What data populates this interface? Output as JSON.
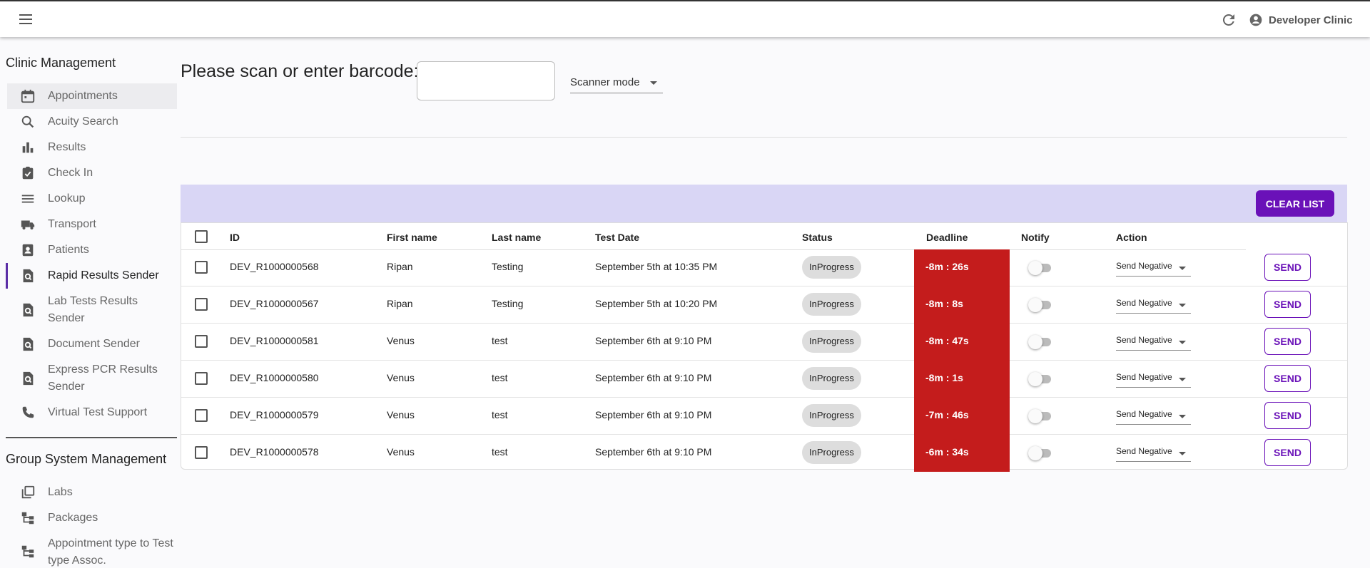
{
  "header": {
    "user_name": "Developer Clinic",
    "menu_icon": "menu-icon",
    "refresh_icon": "refresh-icon",
    "account_icon": "account-circle-icon"
  },
  "sidebar": {
    "clinic_title": "Clinic Management",
    "clinic_items": [
      {
        "label": "Appointments",
        "icon": "calendar-icon"
      },
      {
        "label": "Acuity Search",
        "icon": "search-icon"
      },
      {
        "label": "Results",
        "icon": "bar-chart-icon"
      },
      {
        "label": "Check In",
        "icon": "clipboard-check-icon"
      },
      {
        "label": "Lookup",
        "icon": "list-icon"
      },
      {
        "label": "Transport",
        "icon": "truck-icon"
      },
      {
        "label": "Patients",
        "icon": "contact-icon"
      },
      {
        "label": "Rapid Results Sender",
        "icon": "document-search-icon"
      },
      {
        "label": "Lab Tests Results Sender",
        "icon": "document-search-icon"
      },
      {
        "label": "Document Sender",
        "icon": "document-search-icon"
      },
      {
        "label": "Express PCR Results Sender",
        "icon": "document-search-icon"
      },
      {
        "label": "Virtual Test Support",
        "icon": "phone-icon"
      }
    ],
    "group_title": "Group System Management",
    "group_items": [
      {
        "label": "Labs",
        "icon": "library-icon"
      },
      {
        "label": "Packages",
        "icon": "hierarchy-icon"
      },
      {
        "label": "Appointment type to Test type Assoc.",
        "icon": "hierarchy-icon"
      }
    ]
  },
  "scan": {
    "label": "Please scan or enter barcode:",
    "input_value": "",
    "mode_label": "Scanner mode"
  },
  "clear_button": "CLEAR LIST",
  "table": {
    "headers": {
      "id": "ID",
      "first": "First name",
      "last": "Last name",
      "date": "Test Date",
      "status": "Status",
      "deadline": "Deadline",
      "notify": "Notify",
      "action": "Action"
    },
    "rows": [
      {
        "id": "DEV_R1000000568",
        "first": "Ripan",
        "last": "Testing",
        "date": "September 5th at 10:35 PM",
        "status": "InProgress",
        "deadline": "-8m : 26s",
        "action": "Send Negative",
        "send": "SEND"
      },
      {
        "id": "DEV_R1000000567",
        "first": "Ripan",
        "last": "Testing",
        "date": "September 5th at 10:20 PM",
        "status": "InProgress",
        "deadline": "-8m : 8s",
        "action": "Send Negative",
        "send": "SEND"
      },
      {
        "id": "DEV_R1000000581",
        "first": "Venus",
        "last": "test",
        "date": "September 6th at 9:10 PM",
        "status": "InProgress",
        "deadline": "-8m : 47s",
        "action": "Send Negative",
        "send": "SEND"
      },
      {
        "id": "DEV_R1000000580",
        "first": "Venus",
        "last": "test",
        "date": "September 6th at 9:10 PM",
        "status": "InProgress",
        "deadline": "-8m : 1s",
        "action": "Send Negative",
        "send": "SEND"
      },
      {
        "id": "DEV_R1000000579",
        "first": "Venus",
        "last": "test",
        "date": "September 6th at 9:10 PM",
        "status": "InProgress",
        "deadline": "-7m : 46s",
        "action": "Send Negative",
        "send": "SEND"
      },
      {
        "id": "DEV_R1000000578",
        "first": "Venus",
        "last": "test",
        "date": "September 6th at 9:10 PM",
        "status": "InProgress",
        "deadline": "-6m : 34s",
        "action": "Send Negative",
        "send": "SEND"
      }
    ]
  },
  "colors": {
    "accent": "#6a11b8",
    "deadline_bg": "#c41c1c",
    "banner": "#d9d6f5"
  }
}
